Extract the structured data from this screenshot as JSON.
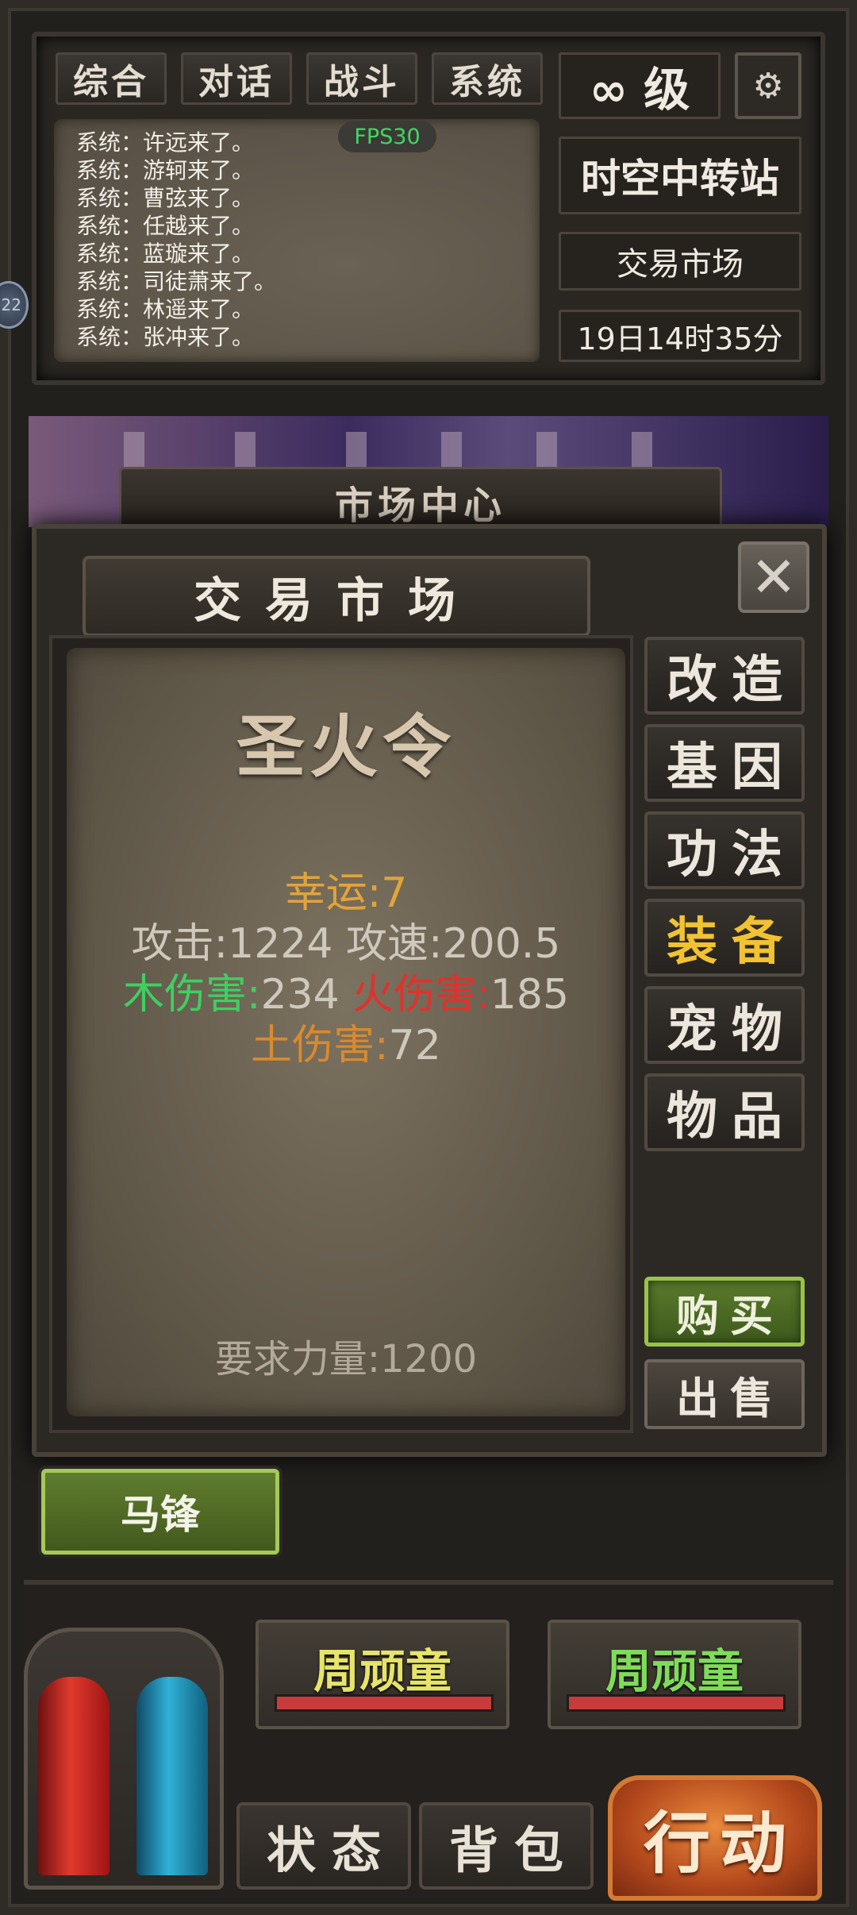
{
  "chat_tabs": [
    "综合",
    "对话",
    "战斗",
    "系统"
  ],
  "fps": "FPS30",
  "chat_messages": [
    "系统：许远来了。",
    "系统：游轲来了。",
    "系统：曹弦来了。",
    "系统：任越来了。",
    "系统：蓝璇来了。",
    "系统：司徒萧来了。",
    "系统：林遥来了。",
    "系统：张冲来了。"
  ],
  "level": "∞ 级",
  "location": "时空中转站",
  "sub_location": "交易市场",
  "game_time": "19日14时35分",
  "edge_badge": "22",
  "banner_title": "市场中心",
  "dialog": {
    "title": "交易市场",
    "close_symbol": "✕",
    "item": {
      "name": "圣火令",
      "luck": "幸运:7",
      "attack": "攻击:1224",
      "attack_speed": "攻速:200.5",
      "wood_label": "木伤害:",
      "wood_value": "234",
      "fire_label": "火伤害:",
      "fire_value": "185",
      "earth_label": "土伤害:",
      "earth_value": "72",
      "requirement": "要求力量:1200"
    },
    "categories": [
      "改造",
      "基因",
      "功法",
      "装备",
      "宠物",
      "物品"
    ],
    "selected_category": "装备",
    "buy": "购买",
    "sell": "出售"
  },
  "player_name_button": "马锋",
  "npcs": [
    {
      "name": "周顽童",
      "color": "#e6e46a",
      "hp": 1.0
    },
    {
      "name": "周顽童",
      "color": "#7fdc5a",
      "hp": 1.0
    }
  ],
  "nav": {
    "status": "状态",
    "bag": "背包",
    "action": "行动"
  },
  "colors": {
    "luck": "#e2a43a",
    "wood": "#3fcf62",
    "fire": "#e2312c",
    "earth": "#d98a2e",
    "stat_grey": "#cfc8bd",
    "selected_category": "#f1c232"
  }
}
